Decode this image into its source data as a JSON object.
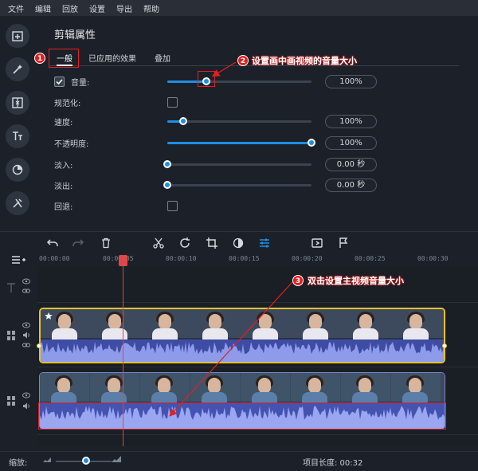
{
  "menu": [
    "文件",
    "编辑",
    "回放",
    "设置",
    "导出",
    "帮助"
  ],
  "left_tools": [
    "import-icon",
    "magic-wand-icon",
    "transition-icon",
    "text-icon",
    "filter-icon",
    "tools-icon"
  ],
  "panel": {
    "title": "剪辑属性",
    "tabs": [
      "一般",
      "已应用的效果",
      "叠加"
    ]
  },
  "properties": {
    "volume": {
      "label": "音量:",
      "value": "100%",
      "level": 0.27,
      "checked": true
    },
    "normalize": {
      "label": "规范化:",
      "checked": false
    },
    "speed": {
      "label": "速度:",
      "value": "100%",
      "level": 0.11
    },
    "opacity": {
      "label": "不透明度:",
      "value": "100%",
      "level": 1.0
    },
    "fade_in": {
      "label": "淡入:",
      "value": "0.00 秒",
      "level": 0.0
    },
    "fade_out": {
      "label": "淡出:",
      "value": "0.00 秒",
      "level": 0.0
    },
    "reverse": {
      "label": "回退:",
      "checked": false
    }
  },
  "timeline_tools": [
    "undo-icon",
    "redo-icon",
    "delete-icon",
    "cut-icon",
    "rotate-icon",
    "crop-icon",
    "color-icon",
    "adjust-icon",
    "clip-properties-icon",
    "marker-icon"
  ],
  "ruler": [
    "00:00:00",
    "00:00:05",
    "00:00:10",
    "00:00:15",
    "00:00:20",
    "00:00:25",
    "00:00:30"
  ],
  "bottom": {
    "zoom_label": "缩放:",
    "project_length": "项目长度: 00:32"
  },
  "annotations": {
    "badge1": "1",
    "badge2": "2",
    "badge3": "3",
    "note2": "设置画中画视频的音量大小",
    "note3": "双击设置主视频音量大小"
  },
  "colors": {
    "accent": "#1e8fe6",
    "pip_clip_border": "#e6c22c",
    "annotation_red": "#e02020"
  }
}
